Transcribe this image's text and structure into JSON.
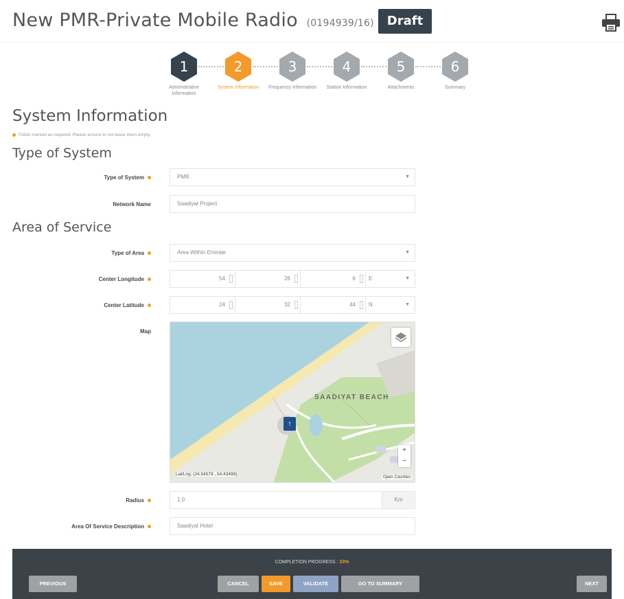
{
  "header": {
    "title": "New PMR-Private Mobile Radio",
    "reference": "(0194939/16)",
    "status_badge": "Draft"
  },
  "stepper": {
    "steps": [
      {
        "number": "1",
        "label": "Administrative Information",
        "state": "completed",
        "color": "#36424c"
      },
      {
        "number": "2",
        "label": "System Information",
        "state": "active",
        "color": "#f39a2b"
      },
      {
        "number": "3",
        "label": "Frequency Information",
        "state": "pending",
        "color": "#a3a9ad"
      },
      {
        "number": "4",
        "label": "Station Information",
        "state": "pending",
        "color": "#a3a9ad"
      },
      {
        "number": "5",
        "label": "Attachments",
        "state": "pending",
        "color": "#a3a9ad"
      },
      {
        "number": "6",
        "label": "Summary",
        "state": "pending",
        "color": "#a3a9ad"
      }
    ]
  },
  "section": {
    "title": "System Information",
    "required_note": "Fields marked as required. Please ensure to not leave them empty."
  },
  "type_of_system": {
    "heading": "Type of System",
    "system_label": "Type of System",
    "system_value": "PMR",
    "network_label": "Network Name",
    "network_value": "Saadiyat Project"
  },
  "area_of_service": {
    "heading": "Area of Service",
    "area_label": "Type of Area",
    "area_value": "Area Within Emirate",
    "longitude_label": "Center Longitude",
    "longitude": {
      "deg": "54",
      "min": "26",
      "sec": "6",
      "dir": "E"
    },
    "latitude_label": "Center Latitude",
    "latitude": {
      "deg": "24",
      "min": "32",
      "sec": "44",
      "dir": "N"
    },
    "map_label": "Map",
    "map": {
      "place_label": "SAADIYAT BEACH",
      "coords_text": "Lat/Lng: (24.54579 , 54.43498)",
      "attribution": "Open Counties",
      "zoom_in": "+",
      "zoom_out": "−"
    },
    "radius_label": "Radius",
    "radius_value": "1.0",
    "radius_unit": "Km",
    "description_label": "Area Of Service Description",
    "description_value": "Saadiyat Hotel"
  },
  "footer": {
    "progress_label": "COMPLETION PROGRESS :",
    "progress_value": "33%",
    "previous": "PREVIOUS",
    "cancel": "CANCEL",
    "save": "SAVE",
    "validate": "VALIDATE",
    "go_to_summary": "GO TO SUMMARY",
    "next": "NEXT"
  }
}
